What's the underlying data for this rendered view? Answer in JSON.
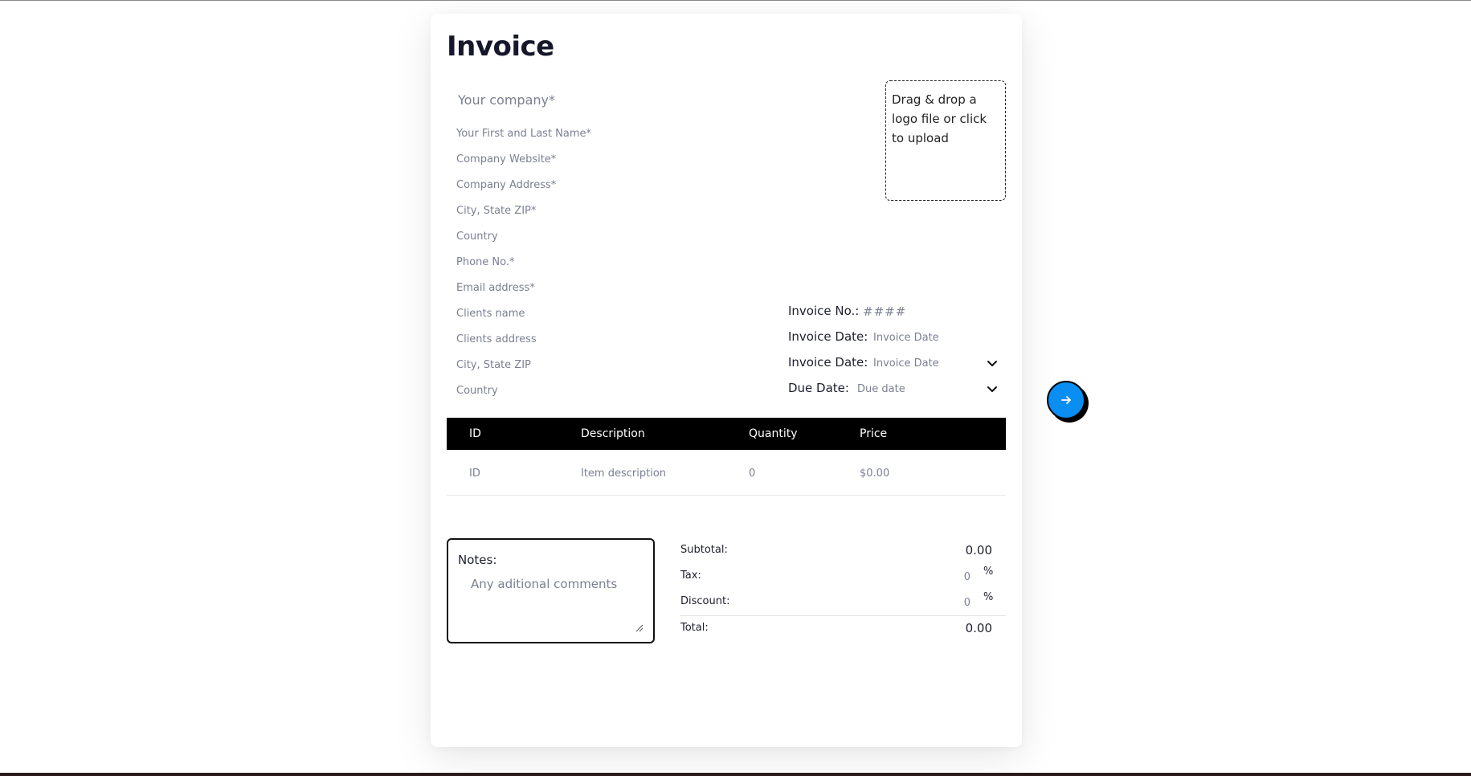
{
  "title": "Invoice",
  "company": {
    "placeholder": "Your company*"
  },
  "sender_fields": [
    {
      "placeholder": "Your First and Last Name*"
    },
    {
      "placeholder": "Company Website*"
    },
    {
      "placeholder": "Company Address*"
    },
    {
      "placeholder": "City, State ZIP*"
    },
    {
      "placeholder": "Country"
    },
    {
      "placeholder": "Phone No.*"
    },
    {
      "placeholder": "Email address*"
    }
  ],
  "client_fields": [
    {
      "placeholder": "Clients name"
    },
    {
      "placeholder": "Clients address"
    },
    {
      "placeholder": "City, State ZIP"
    },
    {
      "placeholder": "Country"
    }
  ],
  "logo_upload": {
    "text": "Drag & drop a logo file or click to upload"
  },
  "invoice_meta": {
    "invoice_no": {
      "label": "Invoice No.:",
      "placeholder": "####"
    },
    "invoice_date": {
      "label": "Invoice Date:",
      "placeholder": "Invoice Date"
    },
    "invoice_date_select": {
      "label": "Invoice Date:",
      "placeholder": "Invoice Date"
    },
    "due_date": {
      "label": "Due Date:",
      "placeholder": "Due date"
    }
  },
  "table": {
    "headers": [
      "ID",
      "Description",
      "Quantity",
      "Price"
    ],
    "row": {
      "id_placeholder": "ID",
      "description_placeholder": "Item description",
      "quantity_placeholder": "0",
      "price_placeholder": "$0.00"
    }
  },
  "notes": {
    "label": "Notes:",
    "placeholder": "Any aditional comments"
  },
  "summary": {
    "subtotal": {
      "label": "Subtotal:",
      "value": "0.00"
    },
    "tax": {
      "label": "Tax:",
      "placeholder": "0",
      "unit": "%"
    },
    "discount": {
      "label": "Discount:",
      "placeholder": "0",
      "unit": "%"
    },
    "total": {
      "label": "Total:",
      "value": "0.00"
    }
  },
  "next_button": {
    "icon": "arrow-right-icon",
    "color": "#0b8ef2"
  },
  "colors": {
    "accent": "#0b8ef2",
    "table_header": "#000000",
    "text": "#1d1f2c",
    "placeholder": "#7b7f92"
  }
}
